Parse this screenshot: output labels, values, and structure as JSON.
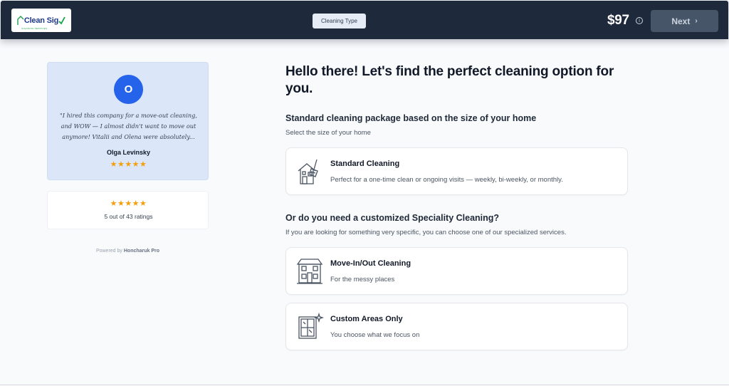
{
  "header": {
    "logo_text": "Clean Sig",
    "logo_subtext": "CLEANING SERVICES",
    "step_label": "Cleaning Type",
    "price": "$97",
    "next_label": "Next",
    "colors": {
      "bar": "#1e293b",
      "button": "#475569"
    }
  },
  "sidebar": {
    "review": {
      "avatar_initial": "O",
      "quote": "\"I hired this company for a move-out cleaning, and WOW — I almost didn't want to move out anymore! Vitalii and Olena were absolutely...",
      "reviewer": "Olga Levinsky",
      "stars": "★★★★★"
    },
    "rating": {
      "stars": "★★★★★",
      "text": "5 out of 43 ratings"
    },
    "powered_prefix": "Powered by",
    "powered_brand": "Honcharuk Pro"
  },
  "main": {
    "headline": "Hello there! Let's find the perfect cleaning option for you.",
    "standard_section": {
      "title": "Standard cleaning package based on the size of your home",
      "subtitle": "Select the size of your home"
    },
    "special_section": {
      "title": "Or do you need a customized Speciality Cleaning?",
      "subtitle": "If you are looking for something very specific, you can choose one of our specialized services."
    },
    "options": [
      {
        "title": "Standard Cleaning",
        "description": "Perfect for a one-time clean or ongoing visits — weekly, bi-weekly, or monthly.",
        "icon": "house-broom-icon"
      },
      {
        "title": "Move-In/Out Cleaning",
        "description": "For the messy places",
        "icon": "building-icon"
      },
      {
        "title": "Custom Areas Only",
        "description": "You choose what we focus on",
        "icon": "window-sparkle-icon"
      }
    ]
  }
}
